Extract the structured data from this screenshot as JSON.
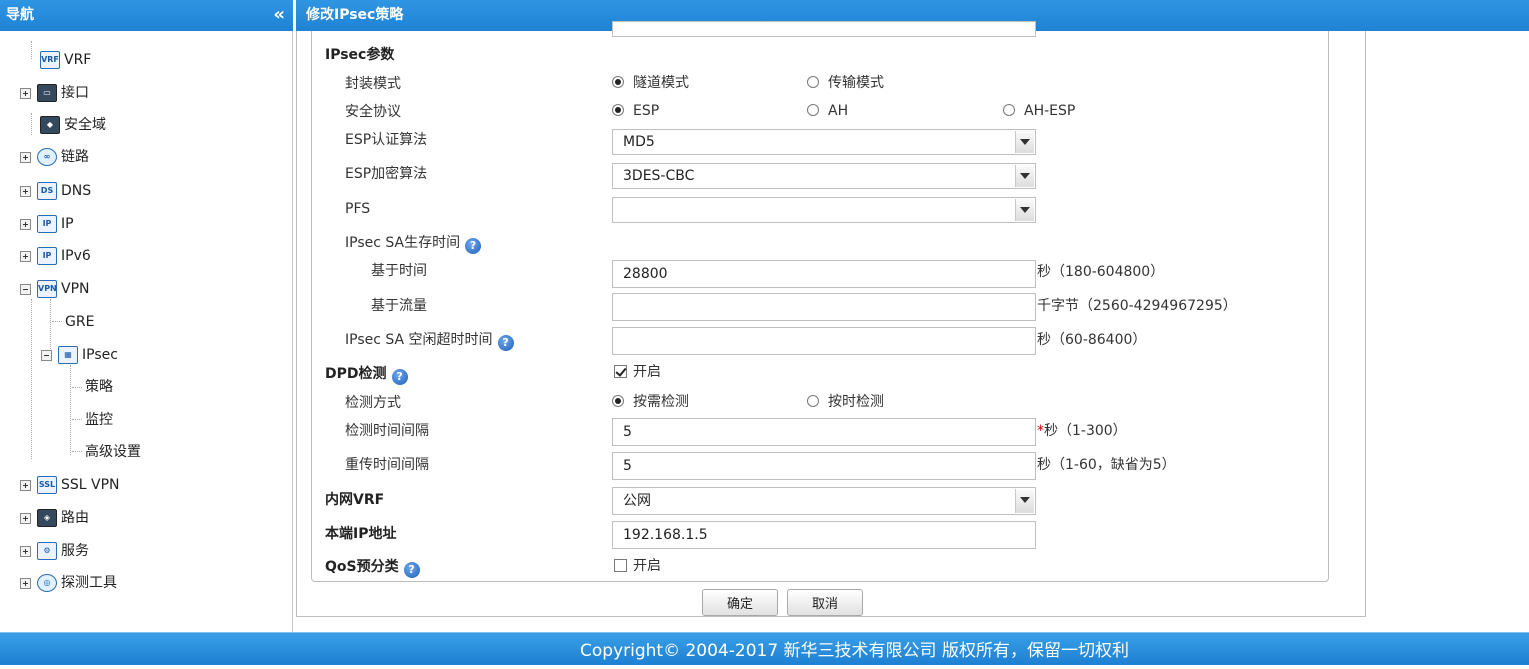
{
  "nav": {
    "title": "导航",
    "collapse": "«",
    "items": [
      {
        "label": "VRF",
        "icon": "VRF"
      },
      {
        "label": "接口",
        "icon": "▭"
      },
      {
        "label": "安全域",
        "icon": "◆"
      },
      {
        "label": "链路",
        "icon": "∞"
      },
      {
        "label": "DNS",
        "icon": "DS"
      },
      {
        "label": "IP",
        "icon": "IP"
      },
      {
        "label": "IPv6",
        "icon": "IP"
      },
      {
        "label": "VPN",
        "icon": "VPN"
      },
      {
        "label": "GRE"
      },
      {
        "label": "IPsec",
        "icon": "▦"
      },
      {
        "label": "策略"
      },
      {
        "label": "监控"
      },
      {
        "label": "高级设置"
      },
      {
        "label": "SSL VPN",
        "icon": "SSL"
      },
      {
        "label": "路由",
        "icon": "◈"
      },
      {
        "label": "服务",
        "icon": "⚙"
      },
      {
        "label": "探测工具",
        "icon": "◎"
      }
    ]
  },
  "panel": {
    "title": "修改IPsec策略"
  },
  "form": {
    "ipsec_params": "IPsec参数",
    "encap_mode": {
      "label": "封装模式",
      "options": [
        "隧道模式",
        "传输模式"
      ],
      "selected": "隧道模式"
    },
    "security_protocol": {
      "label": "安全协议",
      "options": [
        "ESP",
        "AH",
        "AH-ESP"
      ],
      "selected": "ESP"
    },
    "esp_auth": {
      "label": "ESP认证算法",
      "value": "MD5"
    },
    "esp_enc": {
      "label": "ESP加密算法",
      "value": "3DES-CBC"
    },
    "pfs": {
      "label": "PFS",
      "value": ""
    },
    "sa_lifetime": {
      "label": "IPsec SA生存时间"
    },
    "time_based": {
      "label": "基于时间",
      "value": "28800",
      "unit": "秒（180-604800）"
    },
    "traffic_based": {
      "label": "基于流量",
      "value": "",
      "unit": "千字节（2560-4294967295）"
    },
    "idle_timeout": {
      "label": "IPsec SA 空闲超时时间",
      "value": "",
      "unit": "秒（60-86400）"
    },
    "dpd": {
      "label": "DPD检测",
      "checkbox": "开启",
      "checked": true
    },
    "detect_mode": {
      "label": "检测方式",
      "options": [
        "按需检测",
        "按时检测"
      ],
      "selected": "按需检测"
    },
    "detect_interval": {
      "label": "检测时间间隔",
      "value": "5",
      "required": "*",
      "unit": "秒（1-300）"
    },
    "retrans_interval": {
      "label": "重传时间间隔",
      "value": "5",
      "unit": "秒（1-60，缺省为5）"
    },
    "inner_vrf": {
      "label": "内网VRF",
      "value": "公网"
    },
    "local_ip": {
      "label": "本端IP地址",
      "value": "192.168.1.5"
    },
    "qos": {
      "label": "QoS预分类",
      "checkbox": "开启",
      "checked": false
    },
    "help_glyph": "?"
  },
  "buttons": {
    "ok": "确定",
    "cancel": "取消"
  },
  "footer": {
    "copyright": "Copyright© 2004-2017 新华三技术有限公司 版权所有，保留一切权利"
  },
  "colors": {
    "header_blue": "#1f82d4",
    "help_blue": "#1d5fb5",
    "required_red": "#d40000"
  }
}
